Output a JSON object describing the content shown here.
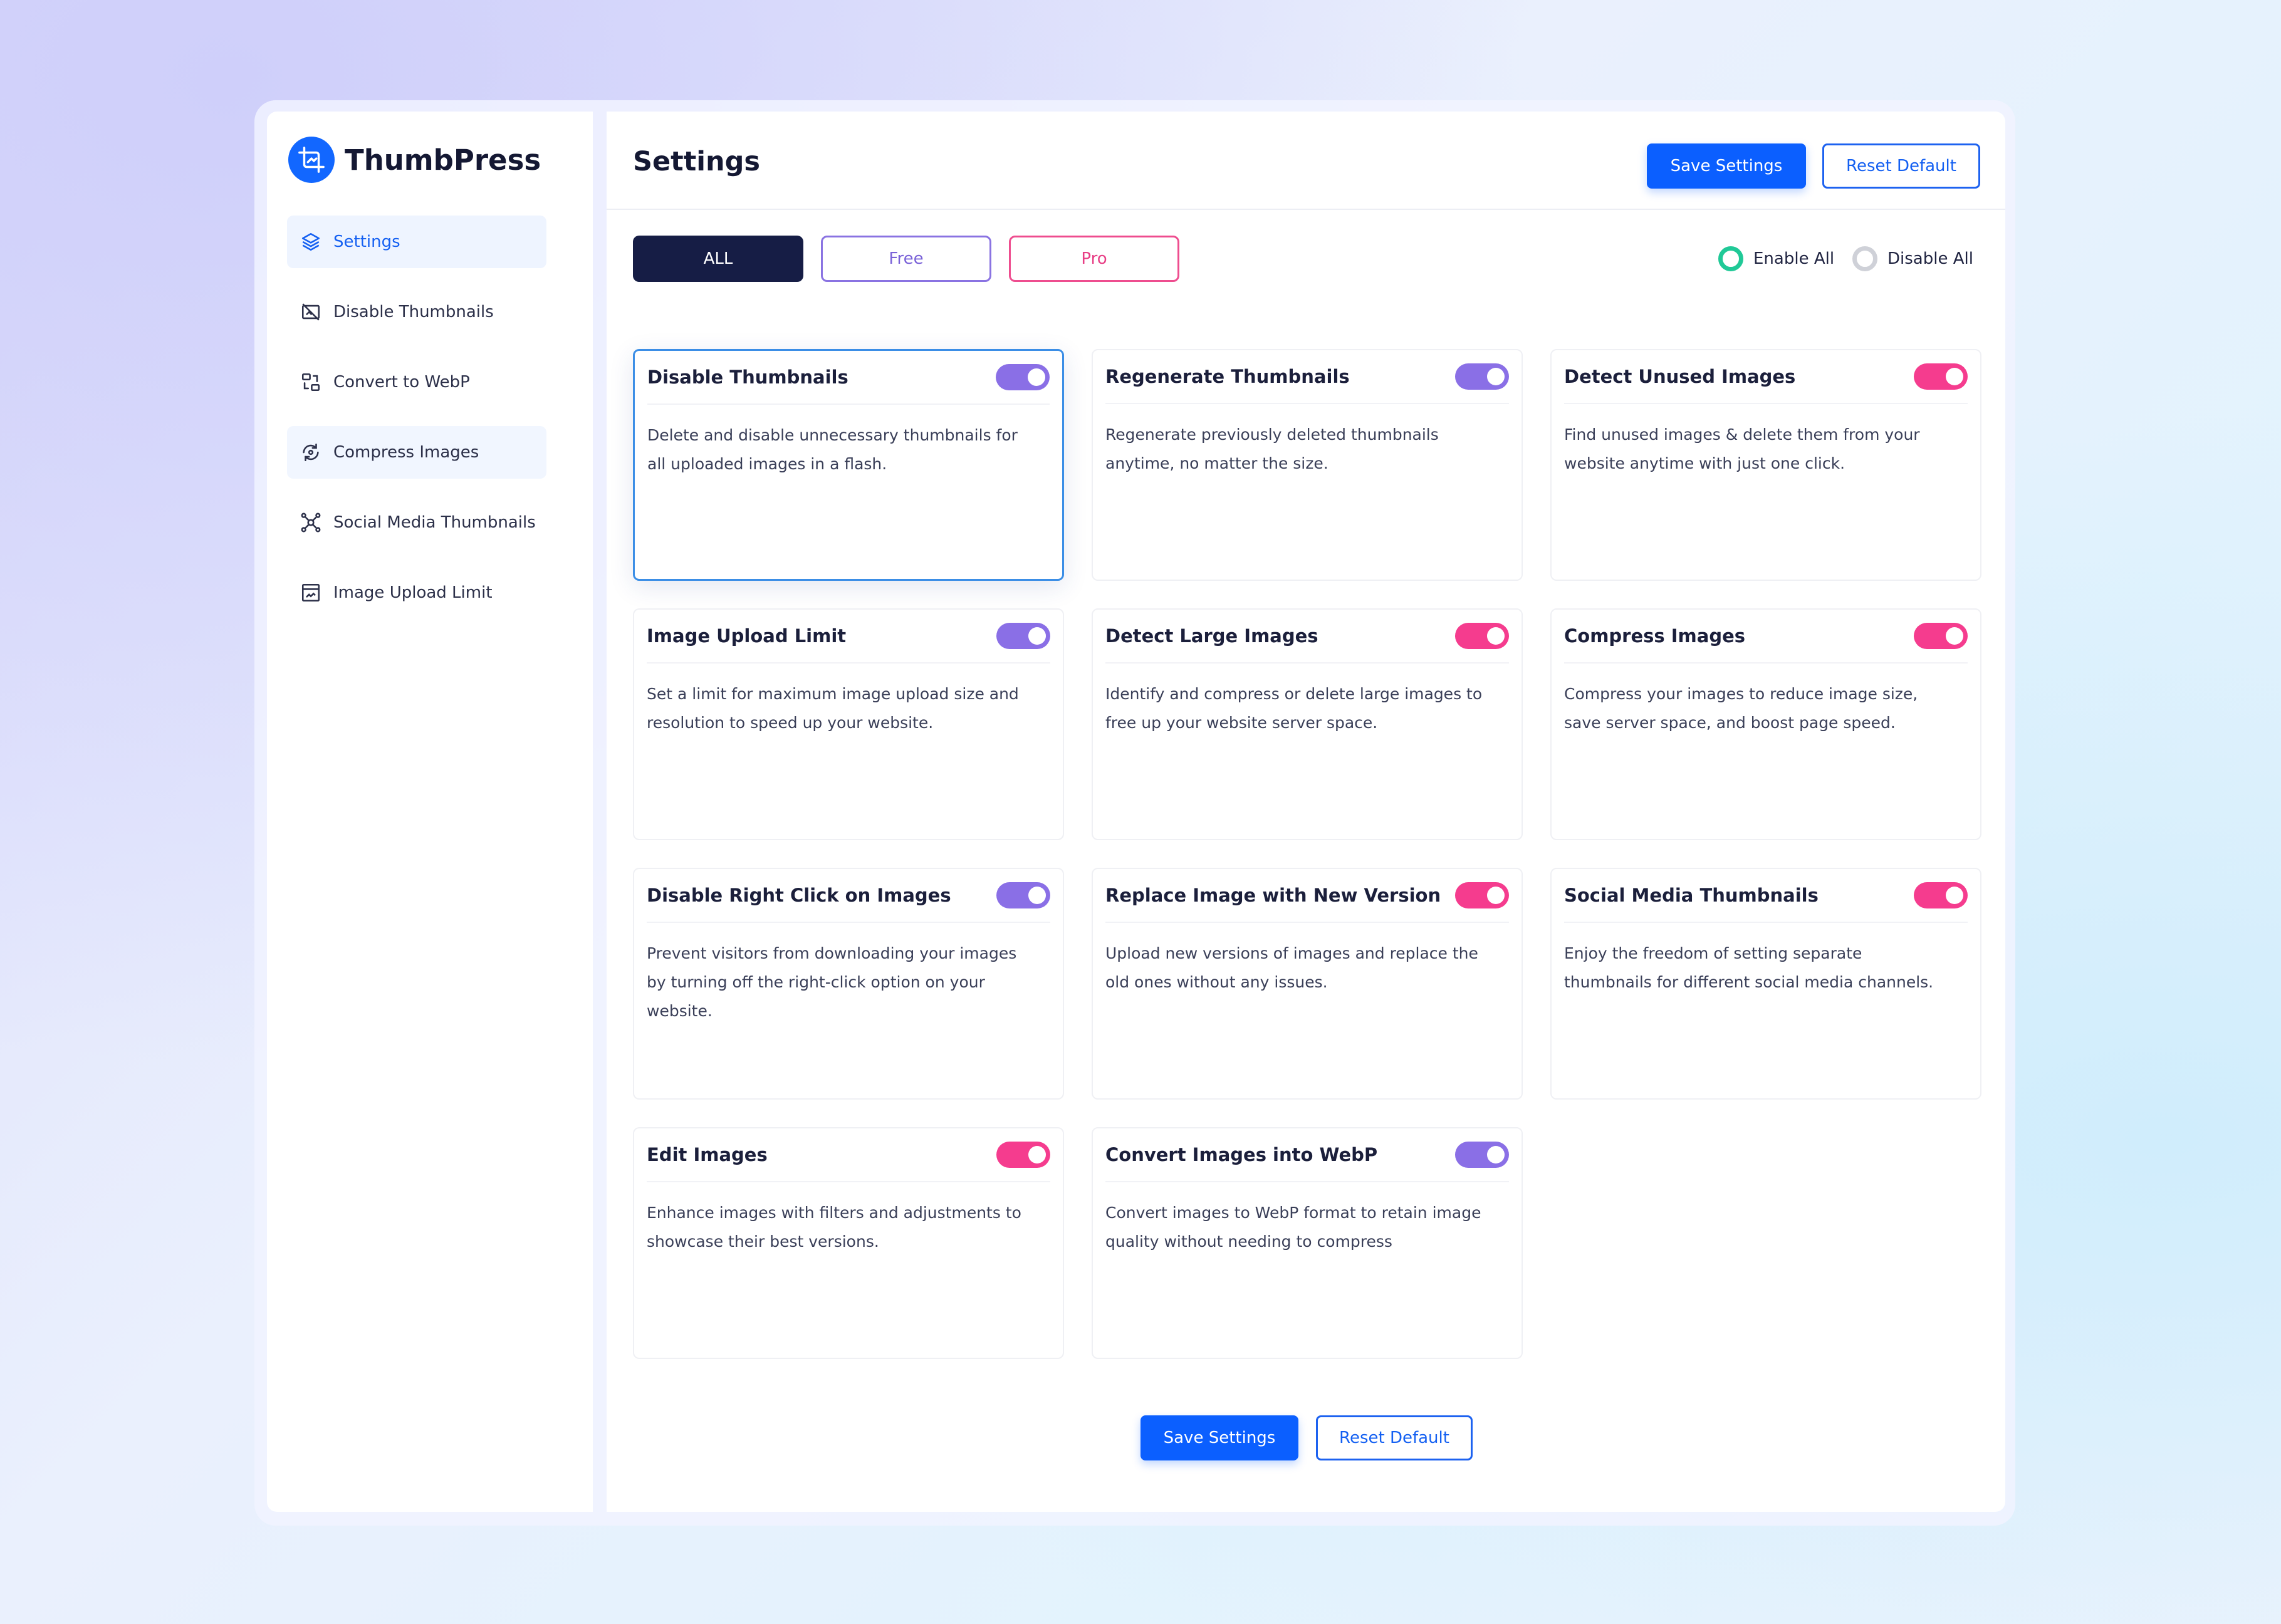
{
  "app": {
    "brand": "ThumbPress",
    "page_title": "Settings"
  },
  "colors": {
    "primary": "#0b5fff",
    "sidebar_active_bg": "#eef4ff",
    "tab_all_bg": "#161d45",
    "free_accent": "#8a73e2",
    "pro_accent": "#ee4d8f",
    "toggle_free": "#8a6fe6",
    "toggle_pro": "#f53c8e",
    "enable_all_ring": "#20c997"
  },
  "sidebar": {
    "items": [
      {
        "label": "Settings",
        "icon": "layers-icon",
        "active": true
      },
      {
        "label": "Disable Thumbnails",
        "icon": "image-off-icon"
      },
      {
        "label": "Convert to WebP",
        "icon": "convert-icon"
      },
      {
        "label": "Compress Images",
        "icon": "compress-icon",
        "hover": true
      },
      {
        "label": "Social Media Thumbnails",
        "icon": "share-icon"
      },
      {
        "label": "Image Upload Limit",
        "icon": "upload-limit-icon"
      }
    ]
  },
  "header": {
    "save_label": "Save Settings",
    "reset_label": "Reset Default"
  },
  "tabs": [
    {
      "label": "ALL",
      "active": true
    },
    {
      "label": "Free"
    },
    {
      "label": "Pro"
    }
  ],
  "bulk": {
    "enable_label": "Enable All",
    "disable_label": "Disable All",
    "selected": "enable"
  },
  "modules": [
    {
      "title": "Disable Thumbnails",
      "desc": "Delete and disable unnecessary thumbnails for all uploaded images in a flash.",
      "tier": "free",
      "enabled": true,
      "selected": true
    },
    {
      "title": "Regenerate Thumbnails",
      "desc": "Regenerate previously deleted thumbnails anytime, no matter the size.",
      "tier": "free",
      "enabled": true
    },
    {
      "title": "Detect Unused Images",
      "desc": "Find unused images & delete them from your website anytime with just one click.",
      "tier": "pro",
      "enabled": true
    },
    {
      "title": "Image Upload Limit",
      "desc": "Set a limit for maximum image upload size and resolution to speed up your website.",
      "tier": "free",
      "enabled": true
    },
    {
      "title": "Detect Large Images",
      "desc": "Identify and compress or delete large images to free up your website server space.",
      "tier": "pro",
      "enabled": true
    },
    {
      "title": "Compress Images",
      "desc": "Compress your images to reduce image size, save server space, and boost page speed.",
      "tier": "pro",
      "enabled": true
    },
    {
      "title": "Disable Right Click on Images",
      "desc": "Prevent visitors from downloading your images by turning off the right-click option on your website.",
      "tier": "free",
      "enabled": true
    },
    {
      "title": "Replace Image with New Version",
      "desc": "Upload new versions of images and replace the old ones without any issues.",
      "tier": "pro",
      "enabled": true
    },
    {
      "title": "Social Media Thumbnails",
      "desc": "Enjoy the freedom of setting separate thumbnails for different social media channels.",
      "tier": "pro",
      "enabled": true
    },
    {
      "title": "Edit Images",
      "desc": "Enhance images with filters and adjustments to showcase their best versions.",
      "tier": "pro",
      "enabled": true
    },
    {
      "title": "Convert Images into WebP",
      "desc": "Convert images to WebP format to retain image quality without needing to compress",
      "tier": "free",
      "enabled": true
    }
  ],
  "footer": {
    "save_label": "Save Settings",
    "reset_label": "Reset Default"
  }
}
